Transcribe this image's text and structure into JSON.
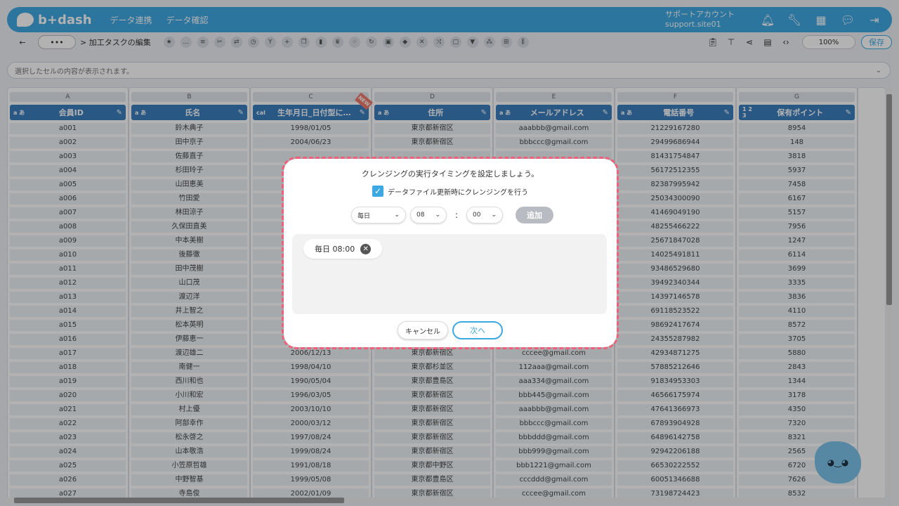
{
  "header": {
    "logo_text": "b+dash",
    "nav": [
      "データ連携",
      "データ確認"
    ],
    "account_label": "サポートアカウント",
    "account_id": "support.site01",
    "icons": [
      "bell-icon",
      "wrench-icon",
      "apps-grid-icon",
      "chat-icon",
      "logout-icon"
    ]
  },
  "toolbar": {
    "back_icon": "←",
    "more_label": "•••",
    "breadcrumb": "> 加工タスクの編集",
    "zoom": "100%",
    "save_label": "保存"
  },
  "cellbar": {
    "text": "選択したセルの内容が表示されます。"
  },
  "grid": {
    "columns": [
      {
        "letter": "A",
        "type": "a あ",
        "name": "会員ID"
      },
      {
        "letter": "B",
        "type": "a あ",
        "name": "氏名"
      },
      {
        "letter": "C",
        "type": "cal",
        "name": "生年月日_日付型に…",
        "badge": "NEW"
      },
      {
        "letter": "D",
        "type": "a あ",
        "name": "住所"
      },
      {
        "letter": "E",
        "type": "a あ",
        "name": "メールアドレス"
      },
      {
        "letter": "F",
        "type": "a あ",
        "name": "電話番号"
      },
      {
        "letter": "G",
        "type": "1 2 3",
        "name": "保有ポイント"
      }
    ],
    "rows": [
      [
        "a001",
        "鈴木典子",
        "1998/01/05",
        "東京都新宿区",
        "aaabbb@gmail.com",
        "21229167280",
        "8954"
      ],
      [
        "a002",
        "田中京子",
        "2004/06/23",
        "東京都新宿区",
        "bbbccc@gmail.com",
        "29499686944",
        "148"
      ],
      [
        "a003",
        "佐藤直子",
        "",
        "",
        "",
        "81431754847",
        "3818"
      ],
      [
        "a004",
        "杉田玲子",
        "",
        "",
        "",
        "56172512355",
        "5937"
      ],
      [
        "a005",
        "山田恵美",
        "",
        "",
        "",
        "82387995942",
        "7458"
      ],
      [
        "a006",
        "竹田愛",
        "",
        "",
        "",
        "25034300090",
        "6167"
      ],
      [
        "a007",
        "林田涼子",
        "",
        "",
        "",
        "41469049190",
        "5157"
      ],
      [
        "a008",
        "久保田直美",
        "",
        "",
        "",
        "48255466222",
        "7956"
      ],
      [
        "a009",
        "中本美樹",
        "",
        "",
        "",
        "25671847028",
        "1247"
      ],
      [
        "a010",
        "後藤徹",
        "",
        "",
        "",
        "14025491811",
        "6114"
      ],
      [
        "a011",
        "田中茂樹",
        "",
        "",
        "",
        "93486529680",
        "3699"
      ],
      [
        "a012",
        "山口茂",
        "",
        "",
        "",
        "39492340344",
        "3335"
      ],
      [
        "a013",
        "渡辺洋",
        "",
        "",
        "",
        "14397146578",
        "3836"
      ],
      [
        "a014",
        "井上智之",
        "",
        "",
        "",
        "69118523522",
        "4110"
      ],
      [
        "a015",
        "松本英明",
        "",
        "",
        "",
        "98692417674",
        "8572"
      ],
      [
        "a016",
        "伊藤恵一",
        "",
        "",
        "",
        "24355287982",
        "3705"
      ],
      [
        "a017",
        "渡辺雄二",
        "2006/12/13",
        "東京都新宿区",
        "cccee@gmail.com",
        "42934871275",
        "5880"
      ],
      [
        "a018",
        "南健一",
        "1998/04/10",
        "東京都杉並区",
        "112aaa@gmail.com",
        "57885212646",
        "2843"
      ],
      [
        "a019",
        "西川和也",
        "1990/05/04",
        "東京都豊島区",
        "aaa334@gmail.com",
        "91834953303",
        "1344"
      ],
      [
        "a020",
        "小川和宏",
        "1996/03/05",
        "東京都新宿区",
        "bbb445@gmail.com",
        "46566175974",
        "3178"
      ],
      [
        "a021",
        "村上優",
        "2003/10/10",
        "東京都新宿区",
        "aaabbb@gmail.com",
        "47641366973",
        "4350"
      ],
      [
        "a022",
        "阿部幸作",
        "2000/03/12",
        "東京都新宿区",
        "bbbccc@gmail.com",
        "67893904928",
        "7320"
      ],
      [
        "a023",
        "松永啓之",
        "1997/08/24",
        "東京都新宿区",
        "bbbddd@gmail.com",
        "64896142758",
        "8321"
      ],
      [
        "a024",
        "山本敬浩",
        "1999/08/24",
        "東京都新宿区",
        "bbb999@gmail.com",
        "92942206188",
        "2565"
      ],
      [
        "a025",
        "小笠原哲雄",
        "1991/08/18",
        "東京都中野区",
        "bbb1221@gmail.com",
        "66530222552",
        "6720"
      ],
      [
        "a026",
        "中野智基",
        "1999/05/08",
        "東京都豊島区",
        "cccddd@gmail.com",
        "60051346688",
        "7626"
      ],
      [
        "a027",
        "寺島俊",
        "2002/01/09",
        "東京都新宿区",
        "cccee@gmail.com",
        "73198724423",
        "8532"
      ]
    ]
  },
  "modal": {
    "title": "クレンジングの実行タイミングを設定しましょう。",
    "checkbox_label": "データファイル更新時にクレンジングを行う",
    "checkbox_checked": true,
    "frequency": "毎日",
    "hour": "08",
    "minute": "00",
    "colon": ":",
    "add_label": "追加",
    "schedules": [
      "毎日 08:00"
    ],
    "cancel_label": "キャンセル",
    "next_label": "次へ"
  }
}
